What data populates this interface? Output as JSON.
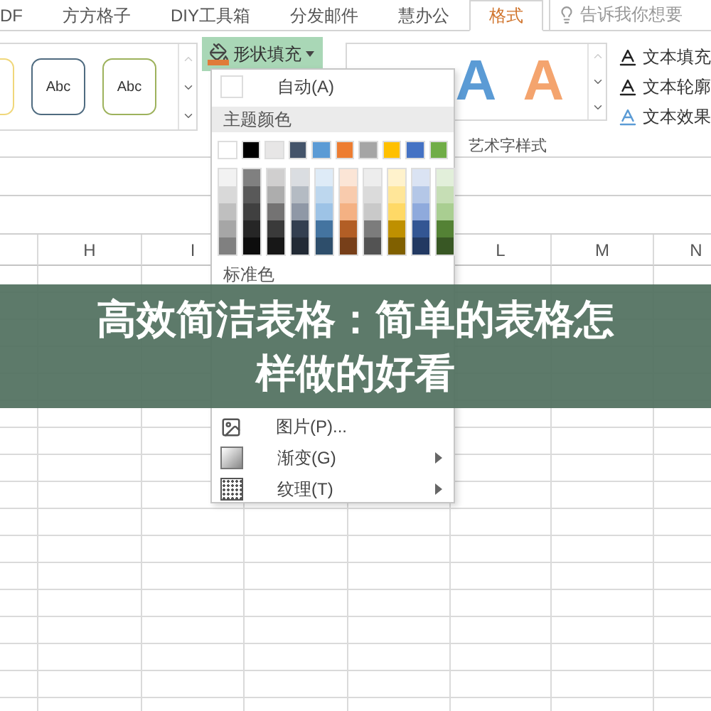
{
  "tabs": [
    {
      "label": "DF",
      "selected": false
    },
    {
      "label": "方方格子",
      "selected": false
    },
    {
      "label": "DIY工具箱",
      "selected": false
    },
    {
      "label": "分发邮件",
      "selected": false
    },
    {
      "label": "慧办公",
      "selected": false
    },
    {
      "label": "格式",
      "selected": true
    }
  ],
  "tell_me": {
    "placeholder": "告诉我你想要"
  },
  "shape_styles": [
    {
      "color": "#f0d77a"
    },
    {
      "label": "Abc",
      "color": "#4f6b80"
    },
    {
      "label": "Abc",
      "color": "#9db25c"
    }
  ],
  "shape_fill": {
    "label": "形状填充",
    "expanded": true
  },
  "wordart_samples": [
    {
      "label": "A",
      "color": "#5b9bd5"
    },
    {
      "label": "A",
      "color": "#f4a46e"
    }
  ],
  "text_commands": [
    {
      "label": "文本填充"
    },
    {
      "label": "文本轮廓"
    },
    {
      "label": "文本效果"
    }
  ],
  "group_label": "艺术字样式",
  "fill_menu": {
    "auto": "自动(A)",
    "theme_header": "主题颜色",
    "theme_colors": [
      {
        "color": "#ffffff"
      },
      {
        "color": "#000000"
      },
      {
        "color": "#e7e6e6"
      },
      {
        "color": "#44546a"
      },
      {
        "color": "#5b9bd5"
      },
      {
        "color": "#ed7d31"
      },
      {
        "color": "#a5a5a5"
      },
      {
        "color": "#ffc000"
      },
      {
        "color": "#4472c4"
      },
      {
        "color": "#70ad47"
      }
    ],
    "standard_header": "标准色",
    "items": [
      {
        "kind": "picture",
        "label": "图片(P)...",
        "submenu": false
      },
      {
        "kind": "gradient",
        "label": "渐变(G)",
        "submenu": true
      },
      {
        "kind": "texture",
        "label": "纹理(T)",
        "submenu": true
      }
    ]
  },
  "columns": [
    {
      "label": "H"
    },
    {
      "label": "I"
    },
    {
      "label": "L"
    },
    {
      "label": "M"
    },
    {
      "label": "N"
    }
  ],
  "banner": {
    "title": "高效简洁表格：简单的表格怎样做的好看"
  }
}
